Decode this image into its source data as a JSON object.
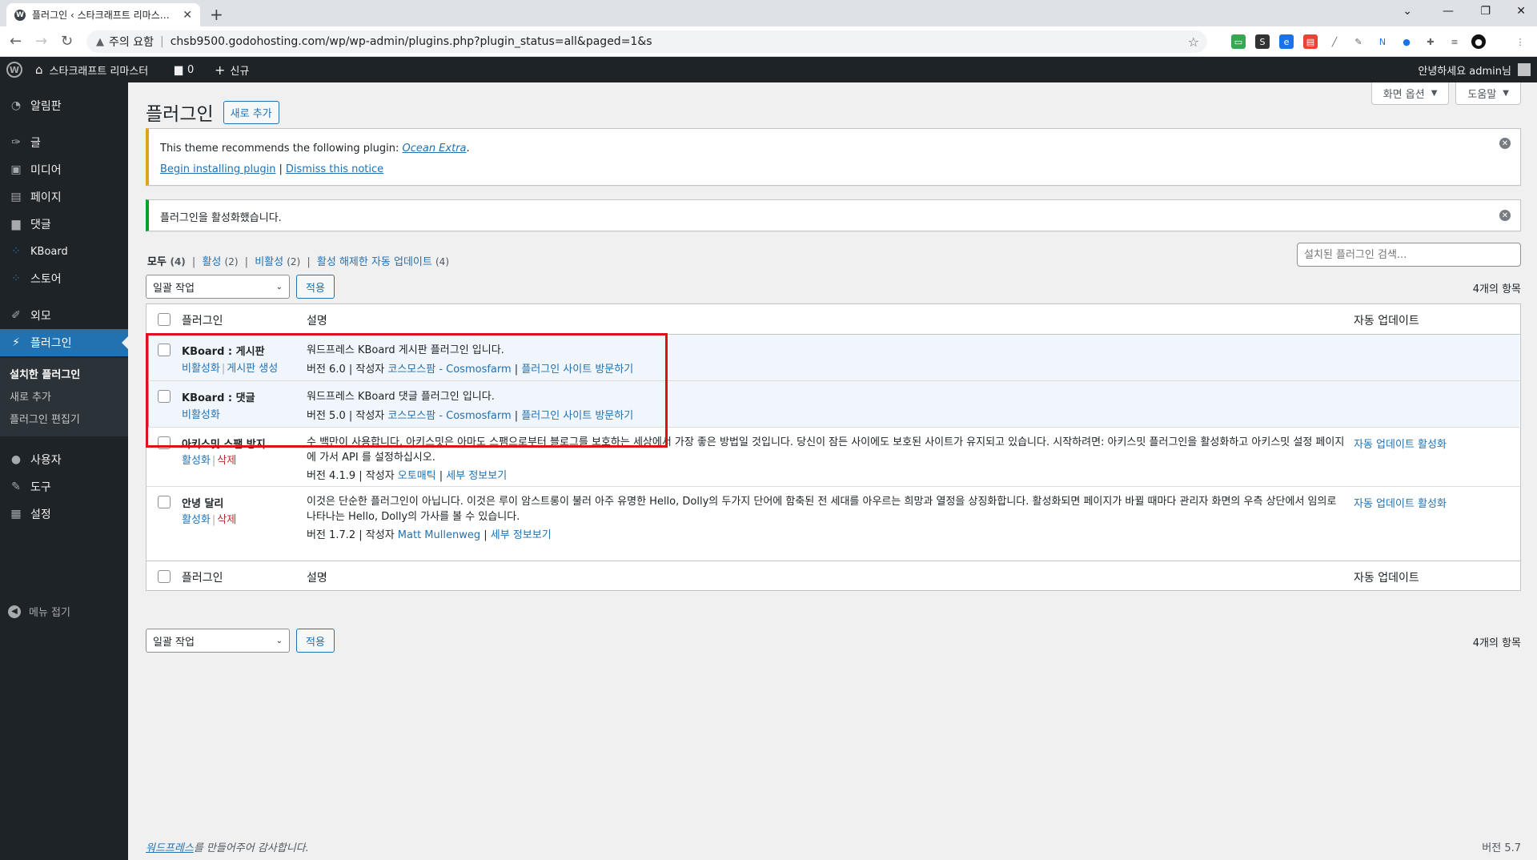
{
  "browser": {
    "tab_title": "플러그인 ‹ 스타크래프트 리마스…",
    "security_label": "주의 요함",
    "url": "chsb9500.godohosting.com/wp/wp-admin/plugins.php?plugin_status=all&paged=1&s"
  },
  "adminbar": {
    "site_name": "스타크래프트 리마스터",
    "comments_count": "0",
    "new_label": "신규",
    "greeting": "안녕하세요 admin님"
  },
  "sidebar": {
    "items": [
      {
        "label": "알림판",
        "icon": "dashboard-icon"
      },
      {
        "label": "글",
        "icon": "pin-icon"
      },
      {
        "label": "미디어",
        "icon": "media-icon"
      },
      {
        "label": "페이지",
        "icon": "page-icon"
      },
      {
        "label": "댓글",
        "icon": "comment-icon"
      },
      {
        "label": "KBoard",
        "icon": "kboard-icon"
      },
      {
        "label": "스토어",
        "icon": "store-icon"
      },
      {
        "label": "외모",
        "icon": "brush-icon"
      },
      {
        "label": "플러그인",
        "icon": "plugin-icon"
      },
      {
        "label": "사용자",
        "icon": "user-icon"
      },
      {
        "label": "도구",
        "icon": "wrench-icon"
      },
      {
        "label": "설정",
        "icon": "settings-icon"
      }
    ],
    "submenu": [
      "설치한 플러그인",
      "새로 추가",
      "플러그인 편집기"
    ],
    "collapse_label": "메뉴 접기"
  },
  "header": {
    "screen_options": "화면 옵션",
    "help": "도움말",
    "title": "플러그인",
    "add_new": "새로 추가"
  },
  "notices": {
    "theme_text": "This theme recommends the following plugin: ",
    "theme_plugin": "Ocean Extra",
    "begin_install": "Begin installing plugin",
    "dismiss": "Dismiss this notice",
    "activated": "플러그인을 활성화했습니다."
  },
  "filters": {
    "all": "모두",
    "all_count": "(4)",
    "active": "활성",
    "active_count": "(2)",
    "inactive": "비활성",
    "inactive_count": "(2)",
    "auto_disabled": "활성 해제한 자동 업데이트",
    "auto_disabled_count": "(4)"
  },
  "search_placeholder": "설치된 플러그인 검색...",
  "bulk": {
    "label": "일괄 작업",
    "apply": "적용",
    "count": "4개의 항목"
  },
  "table": {
    "col_plugin": "플러그인",
    "col_desc": "설명",
    "col_auto": "자동 업데이트",
    "rows": [
      {
        "name": "KBoard : 게시판",
        "action1": "비활성화",
        "action2": "게시판 생성",
        "desc": "워드프레스 KBoard 게시판 플러그인 입니다.",
        "version": "버전 6.0 | 작성자 ",
        "author": "코스모스팜 - Cosmosfarm",
        "sep": " | ",
        "site": "플러그인 사이트 방문하기",
        "auto": ""
      },
      {
        "name": "KBoard : 댓글",
        "action1": "비활성화",
        "desc": "워드프레스 KBoard 댓글 플러그인 입니다.",
        "version": "버전 5.0 | 작성자 ",
        "author": "코스모스팜 - Cosmosfarm",
        "sep": " | ",
        "site": "플러그인 사이트 방문하기",
        "auto": ""
      },
      {
        "name": "아키스밋 스팸 방지",
        "action1": "활성화",
        "action2": "삭제",
        "desc": "수 백만이 사용합니다, 아키스밋은 아마도 스팸으로부터 블로그를 보호하는 세상에서 가장 좋은 방법일 것입니다. 당신이 잠든 사이에도 보호된 사이트가 유지되고 있습니다. 시작하려면: 아키스밋 플러그인을 활성화하고 아키스밋 설정 페이지에 가서 API 를 설정하십시오.",
        "version": "버전 4.1.9 | 작성자 ",
        "author": "오토매틱",
        "sep": " | ",
        "site": "세부 정보보기",
        "auto": "자동 업데이트 활성화"
      },
      {
        "name": "안녕 달리",
        "action1": "활성화",
        "action2": "삭제",
        "desc": "이것은 단순한 플러그인이 아닙니다. 이것은 루이 암스트롱이 불러 아주 유명한 Hello, Dolly의 두가지 단어에 함축된 전 세대를 아우르는 희망과 열정을 상징화합니다. 활성화되면 페이지가 바뀔 때마다 관리자 화면의 우측 상단에서 임의로 나타나는 Hello, Dolly의 가사를 볼 수 있습니다.",
        "version": "버전 1.7.2 | 작성자 ",
        "author": "Matt Mullenweg",
        "sep": " | ",
        "site": "세부 정보보기",
        "auto": "자동 업데이트 활성화"
      }
    ]
  },
  "footer": {
    "thanks_link": "워드프레스",
    "thanks_rest": "를 만들어주어 감사합니다.",
    "version": "버전 5.7"
  }
}
